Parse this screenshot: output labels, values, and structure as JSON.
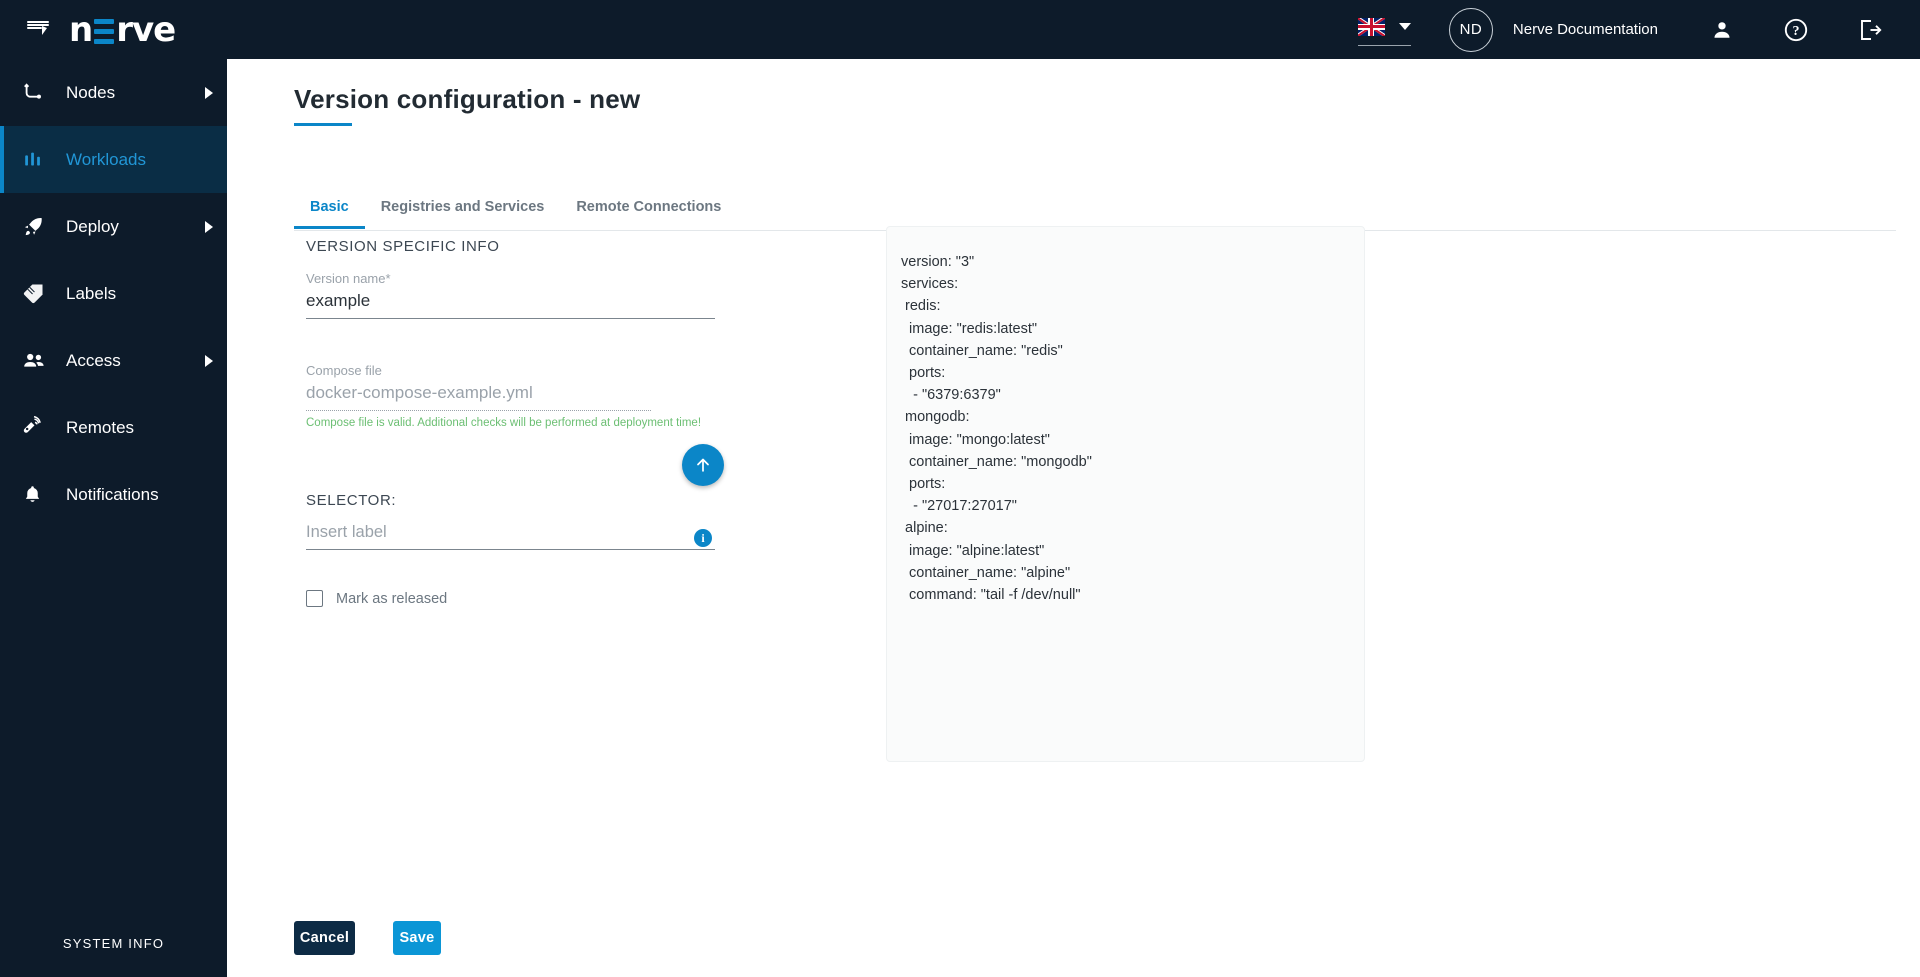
{
  "topbar": {
    "menu_icon": "hamburger-menu-icon",
    "logo_text_left": "n",
    "logo_text_right": "rve",
    "language_flag": "united-kingdom-flag-icon",
    "avatar_initials": "ND",
    "user_name": "Nerve Documentation",
    "user_icon": "person-icon",
    "help_icon": "question-mark-icon",
    "logout_icon": "logout-icon"
  },
  "sidebar": {
    "items": [
      {
        "label": "Nodes",
        "icon": "nodes-icon",
        "has_arrow": true,
        "active": false
      },
      {
        "label": "Workloads",
        "icon": "workloads-icon",
        "has_arrow": false,
        "active": true
      },
      {
        "label": "Deploy",
        "icon": "rocket-icon",
        "has_arrow": true,
        "active": false
      },
      {
        "label": "Labels",
        "icon": "tag-icon",
        "has_arrow": false,
        "active": false
      },
      {
        "label": "Access",
        "icon": "people-icon",
        "has_arrow": true,
        "active": false
      },
      {
        "label": "Remotes",
        "icon": "remote-control-icon",
        "has_arrow": false,
        "active": false
      },
      {
        "label": "Notifications",
        "icon": "bell-icon",
        "has_arrow": false,
        "active": false
      }
    ],
    "system_info": "SYSTEM INFO"
  },
  "page": {
    "title": "Version configuration - new",
    "tabs": [
      {
        "label": "Basic",
        "active": true
      },
      {
        "label": "Registries and Services",
        "active": false
      },
      {
        "label": "Remote Connections",
        "active": false
      }
    ]
  },
  "form": {
    "section_title": "VERSION SPECIFIC INFO",
    "version_name": {
      "label": "Version name*",
      "value": "example",
      "placeholder": ""
    },
    "compose_file": {
      "label": "Compose file",
      "value": "docker-compose-example.yml",
      "placeholder": "",
      "validation_message": "Compose file is valid. Additional checks will be performed at deployment time!",
      "validation_color": "#6cbf73",
      "upload_icon": "upload-arrow-icon"
    },
    "selector": {
      "label": "SELECTOR:",
      "placeholder": "Insert label",
      "value": "",
      "info_icon": "info-icon"
    },
    "mark_released": {
      "label": "Mark as released",
      "checked": false
    }
  },
  "yaml_preview": {
    "lines": [
      "version: \"3\"",
      "services:",
      " redis:",
      "  image: \"redis:latest\"",
      "  container_name: \"redis\"",
      "  ports:",
      "   - \"6379:6379\"",
      " mongodb:",
      "  image: \"mongo:latest\"",
      "  container_name: \"mongodb\"",
      "  ports:",
      "   - \"27017:27017\"",
      " alpine:",
      "  image: \"alpine:latest\"",
      "  container_name: \"alpine\"",
      "  command: \"tail -f /dev/null\""
    ]
  },
  "footer": {
    "cancel_label": "Cancel",
    "save_label": "Save"
  },
  "colors": {
    "brand_blue": "#0b86c8",
    "dark_navy": "#0d1b2a",
    "save_blue": "#0b96d6",
    "cancel_navy": "#0d2b45",
    "valid_green": "#6cbf73"
  }
}
